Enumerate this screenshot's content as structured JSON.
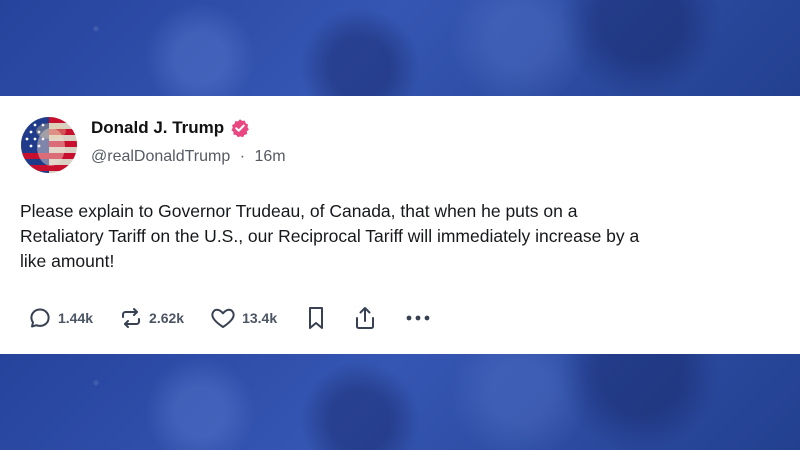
{
  "post": {
    "author_name": "Donald J. Trump",
    "handle": "@realDonaldTrump",
    "separator": "·",
    "time_ago": "16m",
    "text_lines": [
      "Please explain to Governor Trudeau, of Canada, that when he puts on a",
      "Retaliatory Tariff on the U.S., our Reciprocal Tariff will immediately increase by a",
      "like amount!"
    ]
  },
  "actions": {
    "replies": "1.44k",
    "reposts": "2.62k",
    "likes": "13.4k",
    "icons": [
      "reply-icon",
      "repost-icon",
      "like-icon",
      "bookmark-icon",
      "share-icon",
      "more-icon"
    ]
  },
  "colors": {
    "verified_badge": "#e8487f",
    "background_band": "#2b4ba8",
    "text": "#16181c",
    "muted": "#555a63"
  }
}
